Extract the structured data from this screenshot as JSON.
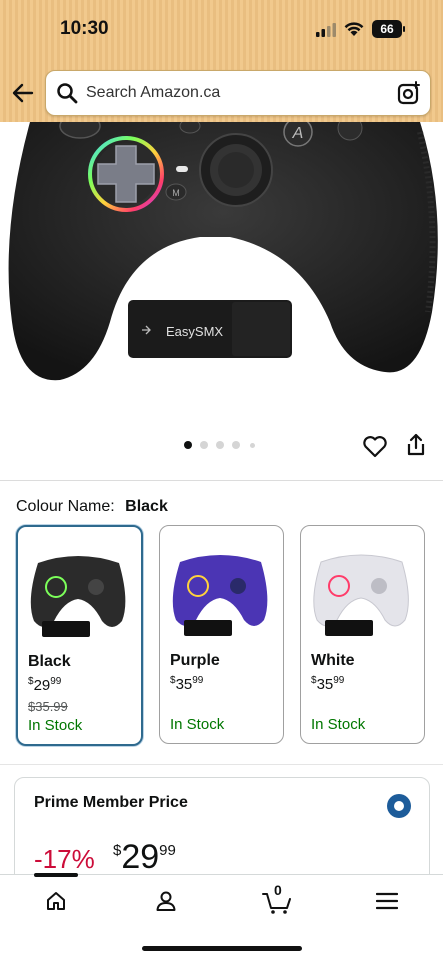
{
  "status_bar": {
    "time": "10:30",
    "battery": "66"
  },
  "search": {
    "placeholder": "Search Amazon.ca"
  },
  "product": {
    "brand_text": "EasySMX",
    "carousel_total": 5,
    "carousel_index": 1
  },
  "colour": {
    "label": "Colour Name:",
    "selected": "Black"
  },
  "variants": [
    {
      "name": "Black",
      "price_symbol": "$",
      "price_main": "29",
      "price_cents": "99",
      "was": "$35.99",
      "stock": "In Stock",
      "color": "#2b2b2b"
    },
    {
      "name": "Purple",
      "price_symbol": "$",
      "price_main": "35",
      "price_cents": "99",
      "was": "",
      "stock": "In Stock",
      "color": "#4b35b4"
    },
    {
      "name": "White",
      "price_symbol": "$",
      "price_main": "35",
      "price_cents": "99",
      "was": "",
      "stock": "In Stock",
      "color": "#e4e4ea"
    }
  ],
  "prime": {
    "title": "Prime Member Price",
    "discount": "-17%",
    "price_symbol": "$",
    "price_main": "29",
    "price_cents": "99"
  },
  "nav": {
    "cart_count": "0"
  },
  "colors": {
    "header": "#f1c98d",
    "link_blue": "#2f6a8e",
    "stock_green": "#007600",
    "discount_red": "#cc0c39"
  }
}
